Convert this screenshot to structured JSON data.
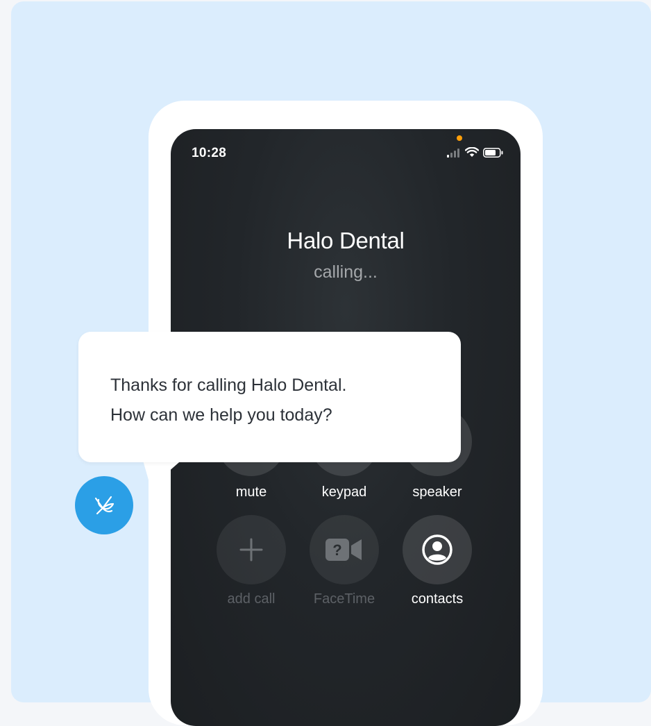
{
  "status_bar": {
    "time": "10:28",
    "icons": [
      "cellular-signal-icon",
      "wifi-icon",
      "battery-icon"
    ],
    "privacy_indicator_color": "#ff9f0a"
  },
  "call": {
    "caller_name": "Halo Dental",
    "status": "calling..."
  },
  "controls": {
    "mute_label": "mute",
    "keypad_label": "keypad",
    "speaker_label": "speaker",
    "add_call_label": "add call",
    "facetime_label": "FaceTime",
    "contacts_label": "contacts",
    "icons": {
      "add_call": "plus-icon",
      "facetime": "facetime-video-icon",
      "contacts": "person-circle-icon"
    }
  },
  "chat": {
    "line1": "Thanks for calling Halo Dental.",
    "line2": "How can we help you today?",
    "avatar_icon": "assistant-logo-icon",
    "avatar_color": "#2b9fe6"
  },
  "colors": {
    "background": "#dbedfd",
    "screen": "#1f2326",
    "accent": "#2b9fe6"
  }
}
